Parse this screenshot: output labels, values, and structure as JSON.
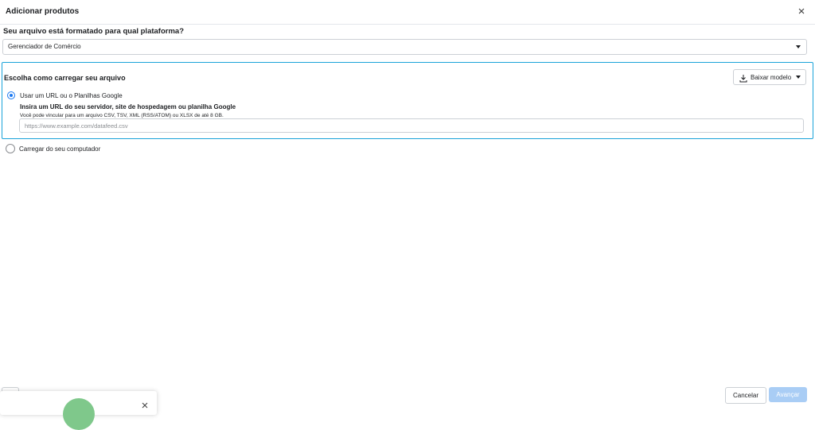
{
  "dialog": {
    "title": "Adicionar produtos"
  },
  "platform": {
    "question": "Seu arquivo está formatado para qual plataforma?",
    "selected": "Gerenciador de Comércio"
  },
  "upload": {
    "section_title": "Escolha como carregar seu arquivo",
    "download_button": "Baixar modelo",
    "option_url": {
      "label": "Usar um URL ou o Planilhas Google",
      "selected": true,
      "subtitle": "Insira um URL do seu servidor, site de hospedagem ou planilha Google",
      "description": "Você pode vincular para um arquivo CSV, TSV, XML (RSS/ATOM) ou XLSX de até 8 GB.",
      "placeholder": "https://www.example.com/datafeed.csv",
      "value": ""
    },
    "option_computer": {
      "label": "Carregar do seu computador",
      "selected": false
    }
  },
  "footer": {
    "cancel": "Cancelar",
    "next": "Avançar"
  },
  "colors": {
    "accent": "#1877f2",
    "section_border": "#1aa3d9",
    "next_disabled": "#a9cdf5"
  },
  "icons": {
    "close": "close-icon",
    "download": "download-icon",
    "caret": "chevron-down-icon"
  }
}
